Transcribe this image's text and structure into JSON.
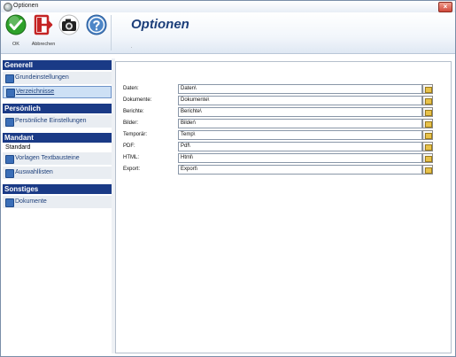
{
  "window": {
    "title": "Optionen",
    "close_glyph": "×"
  },
  "toolbar": {
    "buttons": [
      {
        "label": "OK",
        "icon": "checkmark-icon",
        "color": "#2ea12a"
      },
      {
        "label": "Abbrechen",
        "icon": "exit-icon",
        "color": "#c42424"
      },
      {
        "label": "",
        "icon": "camera-icon",
        "color": "#222222"
      },
      {
        "label": "",
        "icon": "help-icon",
        "color": "#4d86c7"
      }
    ]
  },
  "header": {
    "title": "Optionen",
    "subtitle": "."
  },
  "sidebar": {
    "sections": [
      {
        "title": "Generell",
        "items": [
          {
            "label": "Grundeinstellungen",
            "active": false
          },
          {
            "label": "Verzeichnisse",
            "active": true
          }
        ]
      },
      {
        "title": "Persönlich",
        "items": [
          {
            "label": "Persönliche Einstellungen",
            "active": false
          }
        ]
      },
      {
        "title": "Mandant",
        "plain": "Standard",
        "items": [
          {
            "label": "Vorlagen Textbausteine",
            "active": false
          },
          {
            "label": "Auswahllisten",
            "active": false
          }
        ]
      },
      {
        "title": "Sonstiges",
        "items": [
          {
            "label": "Dokumente",
            "active": false
          }
        ]
      }
    ]
  },
  "directories": [
    {
      "label": "Daten:",
      "value": "Daten\\"
    },
    {
      "label": "Dokumente:",
      "value": "Dokumente\\"
    },
    {
      "label": "Berichte:",
      "value": "Berichte\\"
    },
    {
      "label": "Bilder:",
      "value": "Bilder\\"
    },
    {
      "label": "Temporär:",
      "value": "Temp\\"
    },
    {
      "label": "PDF:",
      "value": "Pdf\\"
    },
    {
      "label": "HTML:",
      "value": "Html\\"
    },
    {
      "label": "Export:",
      "value": "Export\\"
    }
  ],
  "colors": {
    "accent": "#1a3a86",
    "title": "#1d3f7a",
    "folder": "#e8c24a"
  }
}
